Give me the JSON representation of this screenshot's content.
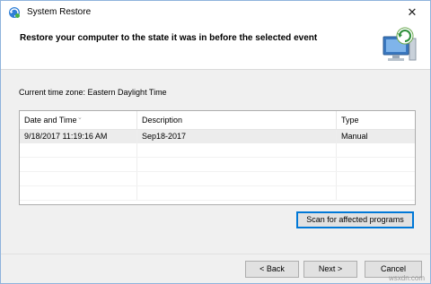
{
  "window": {
    "title": "System Restore",
    "close_glyph": "✕"
  },
  "header": {
    "title": "Restore your computer to the state it was in before the selected event",
    "icon": "system-restore-computer-icon"
  },
  "timezone_label": "Current time zone: Eastern Daylight Time",
  "table": {
    "columns": [
      "Date and Time",
      "Description",
      "Type"
    ],
    "rows": [
      {
        "date": "9/18/2017 11:19:16 AM",
        "description": "Sep18-2017",
        "type": "Manual",
        "selected": true
      }
    ]
  },
  "buttons": {
    "scan": "Scan for affected programs",
    "back": "< Back",
    "next": "Next >",
    "cancel": "Cancel"
  },
  "watermark": "wsxdn.com",
  "colors": {
    "accent": "#0078d7",
    "window_border": "#8fb3dc",
    "dialog_bg": "#f0f0f0",
    "selected_row": "#ececec"
  }
}
